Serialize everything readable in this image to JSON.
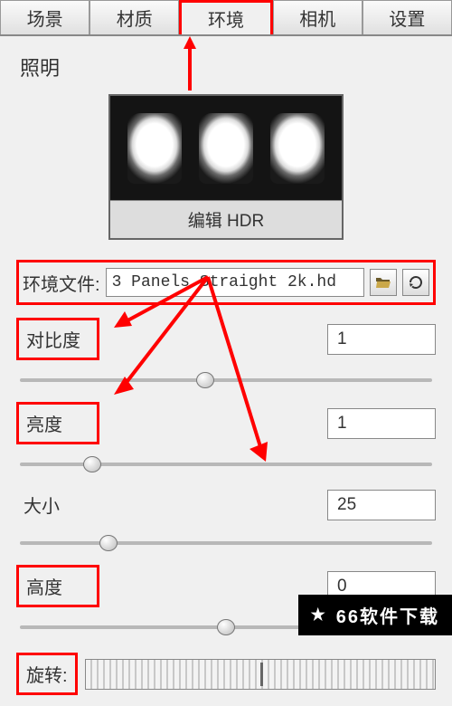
{
  "tabs": {
    "scene": "场景",
    "material": "材质",
    "environment": "环境",
    "camera": "相机",
    "settings": "设置"
  },
  "section_title": "照明",
  "hdr_edit": "编辑 HDR",
  "file": {
    "label": "环境文件:",
    "value": "3 Panels Straight 2k.hd"
  },
  "params": {
    "contrast_label": "对比度",
    "contrast_value": "1",
    "brightness_label": "亮度",
    "brightness_value": "1",
    "size_label": "大小",
    "size_value": "25",
    "height_label": "高度",
    "height_value": "0",
    "rotate_label": "旋转:"
  },
  "watermark": "66软件下载"
}
